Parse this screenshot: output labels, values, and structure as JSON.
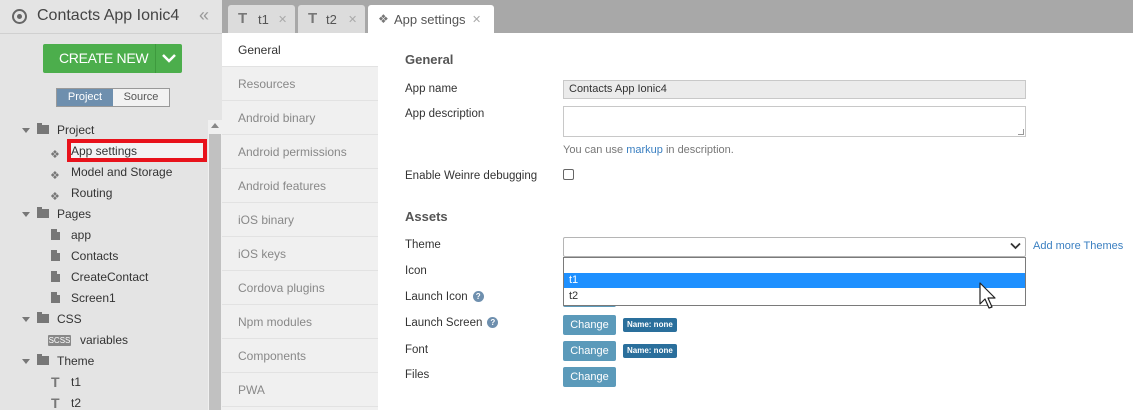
{
  "app": {
    "title": "Contacts App Ionic4",
    "create_label": "CREATE NEW",
    "segments": [
      "Project",
      "Source"
    ]
  },
  "tree": {
    "project": "Project",
    "app_settings": "App settings",
    "model_storage": "Model and Storage",
    "routing": "Routing",
    "pages": "Pages",
    "page_app": "app",
    "page_contacts": "Contacts",
    "page_create": "CreateContact",
    "page_screen1": "Screen1",
    "css": "CSS",
    "scss_badge": "SCSS",
    "variables": "variables",
    "theme": "Theme",
    "t1": "t1",
    "t2": "t2"
  },
  "tabs": [
    {
      "label": "t1",
      "icon": "T"
    },
    {
      "label": "t2",
      "icon": "T"
    },
    {
      "label": "App settings",
      "icon": "settings"
    }
  ],
  "settings_nav": [
    "General",
    "Resources",
    "Android binary",
    "Android permissions",
    "Android features",
    "iOS binary",
    "iOS keys",
    "Cordova plugins",
    "Npm modules",
    "Components",
    "PWA"
  ],
  "form": {
    "general_heading": "General",
    "app_name_label": "App name",
    "app_name_value": "Contacts App Ionic4",
    "app_desc_label": "App description",
    "desc_help_pre": "You can use ",
    "desc_help_link": "markup",
    "desc_help_post": " in description.",
    "weinre_label": "Enable Weinre debugging",
    "assets_heading": "Assets",
    "theme_label": "Theme",
    "add_themes": "Add more Themes",
    "theme_options": [
      "t1",
      "t2"
    ],
    "icon_label": "Icon",
    "launch_icon_label": "Launch Icon",
    "launch_screen_label": "Launch Screen",
    "font_label": "Font",
    "files_label": "Files",
    "change_label": "Change",
    "name_badge": "Name: none",
    "help_glyph": "?"
  },
  "colors": {
    "accent_green": "#4cae4c",
    "highlight_red": "#e8121b",
    "option_highlight": "#1e90ff",
    "button_blue": "#5b9aba",
    "link_blue": "#3a7fc1"
  }
}
